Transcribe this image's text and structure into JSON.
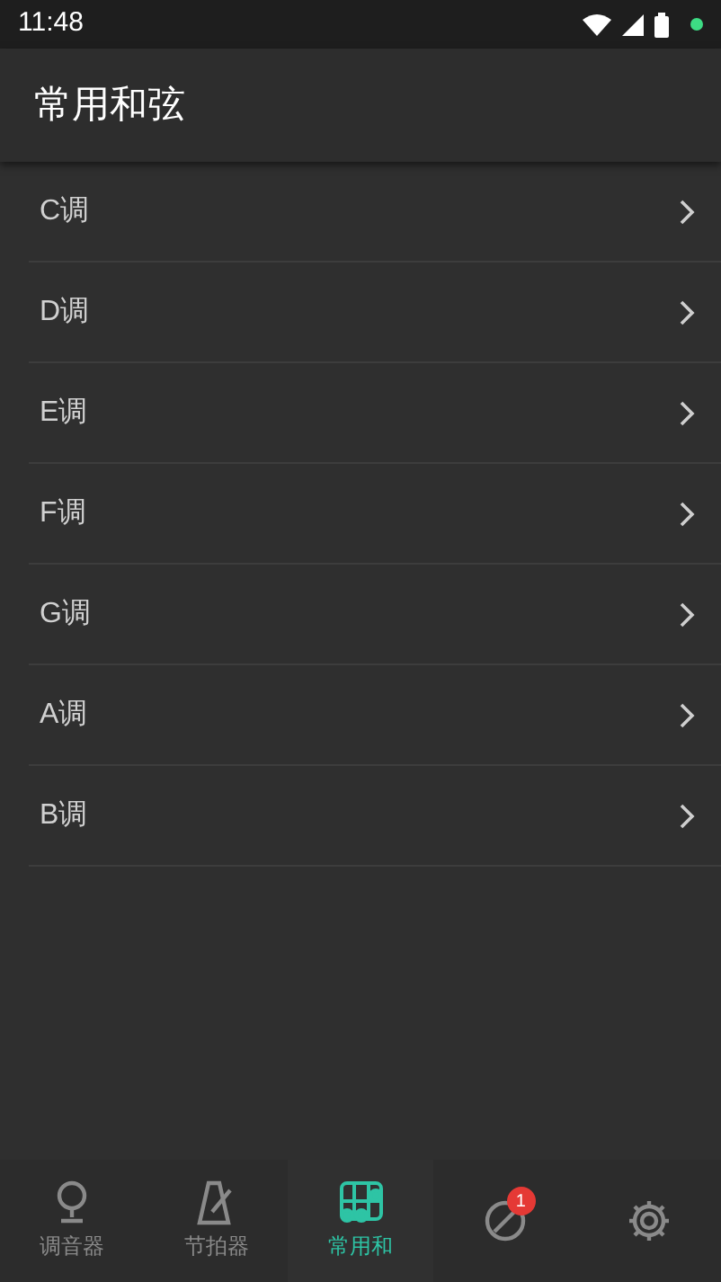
{
  "status_bar": {
    "time": "11:48"
  },
  "header": {
    "title": "常用和弦"
  },
  "keys": [
    {
      "label": "C调"
    },
    {
      "label": "D调"
    },
    {
      "label": "E调"
    },
    {
      "label": "F调"
    },
    {
      "label": "G调"
    },
    {
      "label": "A调"
    },
    {
      "label": "B调"
    }
  ],
  "bottom_nav": [
    {
      "kind": "pin",
      "label": "调音器",
      "selected": false
    },
    {
      "kind": "metronome",
      "label": "节拍器",
      "selected": false
    },
    {
      "kind": "chord",
      "label": "常用和",
      "selected": true
    },
    {
      "kind": "ear",
      "badge": "1",
      "selected": false
    },
    {
      "kind": "gear",
      "selected": false
    }
  ]
}
